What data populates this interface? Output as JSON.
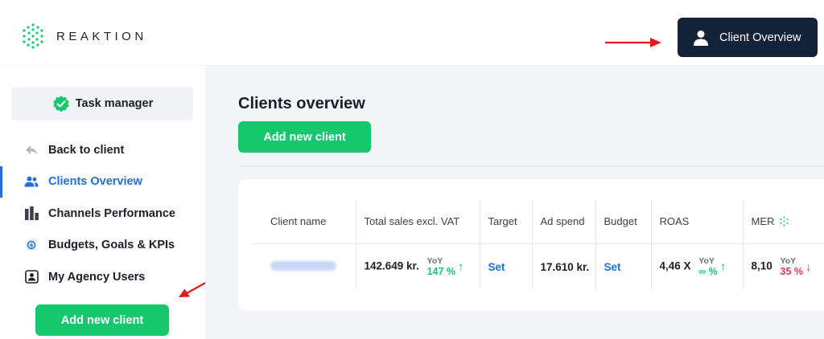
{
  "header": {
    "logo_text": "REAKTION",
    "overview_button": "Client Overview"
  },
  "sidebar": {
    "task_manager": "Task manager",
    "items": [
      {
        "label": "Back to client",
        "icon": "back-arrow-icon"
      },
      {
        "label": "Clients Overview",
        "icon": "users-icon",
        "active": true
      },
      {
        "label": "Channels Performance",
        "icon": "bar-chart-icon"
      },
      {
        "label": "Budgets, Goals & KPIs",
        "icon": "coin-icon"
      },
      {
        "label": "My Agency Users",
        "icon": "user-card-icon"
      }
    ],
    "add_button": "Add new client"
  },
  "main": {
    "title": "Clients overview",
    "add_button": "Add new client",
    "table": {
      "headers": [
        "Client name",
        "Total sales excl. VAT",
        "Target",
        "Ad spend",
        "Budget",
        "ROAS",
        "MER"
      ],
      "row": {
        "total_sales": "142.649 kr.",
        "total_sales_yoy_label": "YoY",
        "total_sales_yoy": "147 %",
        "target": "Set",
        "ad_spend": "17.610 kr.",
        "budget": "Set",
        "roas": "4,46 X",
        "roas_yoy_label": "YoY",
        "roas_yoy": "∞ %",
        "mer": "8,10",
        "mer_yoy_label": "YoY",
        "mer_yoy": "35 %"
      }
    }
  },
  "colors": {
    "navy": "#14223a",
    "green": "#17c76d",
    "blue": "#1f6fe0",
    "red": "#e5395b",
    "arrow_red": "#e01b1b"
  }
}
